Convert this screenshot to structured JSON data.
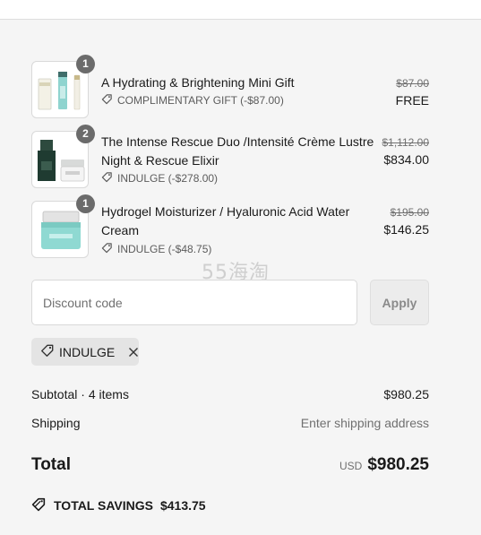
{
  "items": [
    {
      "quantity": "1",
      "title": "A Hydrating & Brightening Mini Gift",
      "discount_label": "COMPLIMENTARY GIFT (-$87.00)",
      "original_price": "$87.00",
      "final_price": "FREE"
    },
    {
      "quantity": "2",
      "title": "The Intense Rescue Duo /Intensité Crème Lustre Night & Rescue Elixir",
      "discount_label": "INDULGE (-$278.00)",
      "original_price": "$1,112.00",
      "final_price": "$834.00"
    },
    {
      "quantity": "1",
      "title": "Hydrogel Moisturizer / Hyaluronic Acid Water Cream",
      "discount_label": "INDULGE (-$48.75)",
      "original_price": "$195.00",
      "final_price": "$146.25"
    }
  ],
  "watermark": "55海淘",
  "discount": {
    "placeholder": "Discount code",
    "value": "",
    "apply_label": "Apply",
    "applied_code": "INDULGE"
  },
  "summary": {
    "subtotal_label": "Subtotal · 4 items",
    "subtotal_value": "$980.25",
    "shipping_label": "Shipping",
    "shipping_value": "Enter shipping address",
    "total_label": "Total",
    "currency": "USD",
    "total_value": "$980.25",
    "savings_label": "TOTAL SAVINGS",
    "savings_value": "$413.75"
  },
  "icons": {
    "tag": "tag-icon",
    "close": "close-icon"
  },
  "colors": {
    "background": "#f5f5f5",
    "badge": "#6b6b6b",
    "muted_text": "#707070",
    "chip": "#e4e4e4"
  }
}
